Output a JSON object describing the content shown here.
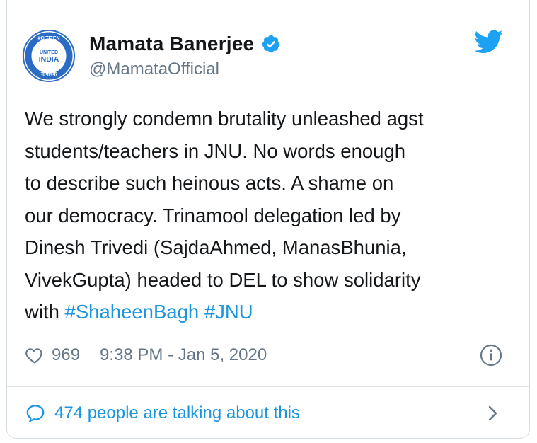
{
  "tweet": {
    "author_name": "Mamata Banerjee",
    "handle": "@MamataOfficial",
    "avatar_text_top": "#CITIZEN",
    "avatar_text_main_1": "UNITED",
    "avatar_text_main_2": "INDIA",
    "avatar_text_bottom": "नागरिक",
    "text_lines": [
      "We strongly condemn brutality unleashed agst",
      "students/teachers in JNU. No words enough",
      "to describe such heinous acts. A shame on",
      "our democracy. Trinamool delegation led by",
      "Dinesh Trivedi (SajdaAhmed, ManasBhunia,",
      "VivekGupta) headed to DEL to show solidarity"
    ],
    "last_line_prefix": "with ",
    "hashtags": [
      "#ShaheenBagh",
      "#JNU"
    ],
    "likes": "969",
    "timestamp": "9:38 PM - Jan 5, 2020",
    "talking_label": "474 people are talking about this"
  },
  "icons": {
    "verified": "verified-badge-icon",
    "bird": "twitter-bird-icon",
    "heart": "heart-outline-icon",
    "info": "info-circle-icon",
    "comment": "comment-bubble-icon",
    "chevron": "chevron-right-icon"
  },
  "colors": {
    "link": "#1b95e0",
    "secondary": "#657786",
    "text": "#14171a",
    "twitter_blue": "#1da1f2"
  }
}
